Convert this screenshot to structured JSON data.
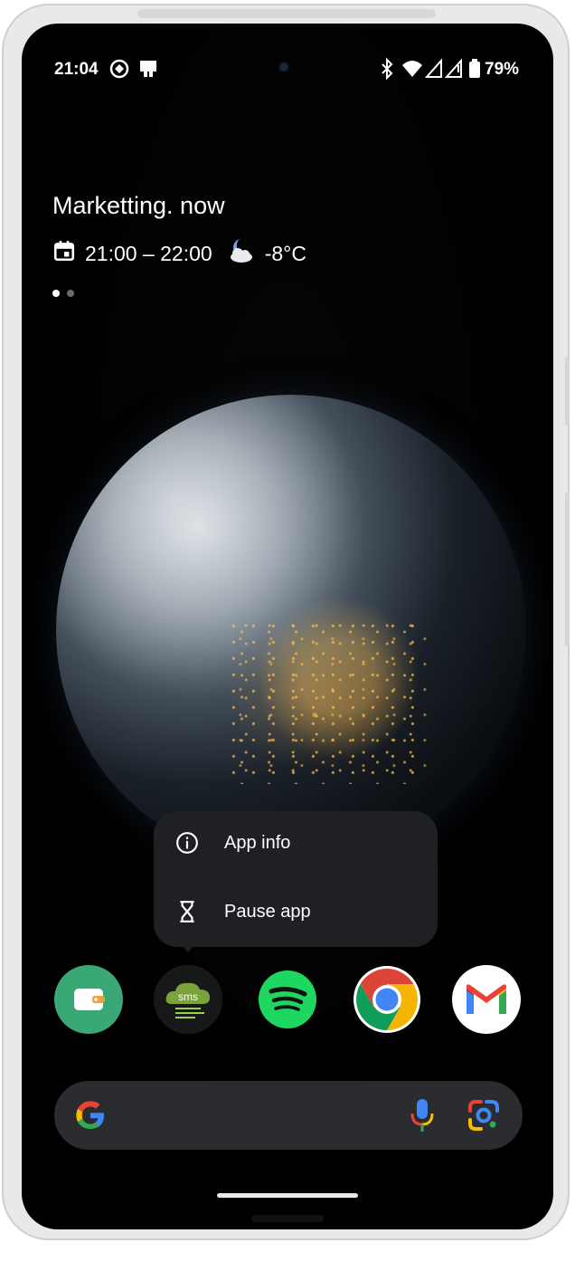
{
  "status_bar": {
    "time": "21:04",
    "battery": "79%",
    "icons": [
      "notification-icon",
      "cast-icon",
      "bluetooth-icon",
      "wifi-icon",
      "signal-icon",
      "signal-2-icon",
      "battery-icon"
    ]
  },
  "glance": {
    "title": "Marketting. now",
    "event_time": "21:00 – 22:00",
    "temperature": "-8°C",
    "icons": [
      "calendar-icon",
      "weather-moon-cloud-icon"
    ]
  },
  "page_indicator": {
    "pages": 2,
    "current": 1
  },
  "popup_menu": {
    "items": [
      {
        "label": "App info",
        "icon": "info-icon"
      },
      {
        "label": "Pause app",
        "icon": "hourglass-icon"
      }
    ]
  },
  "dock": {
    "apps": [
      {
        "name": "Wallet",
        "icon": "wallet-app-icon",
        "color": "#3aa874"
      },
      {
        "name": "SMS",
        "icon": "sms-cloud-app-icon",
        "label": "sms",
        "color": "#7aa33a"
      },
      {
        "name": "Spotify",
        "icon": "spotify-app-icon",
        "color": "#1ed760"
      },
      {
        "name": "Chrome",
        "icon": "chrome-app-icon",
        "color": "#4285f4"
      },
      {
        "name": "Gmail",
        "icon": "gmail-app-icon",
        "color": "#ea4335"
      }
    ]
  },
  "search": {
    "icons": [
      "google-g-icon",
      "microphone-icon",
      "lens-icon"
    ]
  },
  "colors": {
    "background": "#000000",
    "popup_bg": "#1f2023",
    "search_bg": "#2b2c30",
    "text": "#ffffff"
  }
}
